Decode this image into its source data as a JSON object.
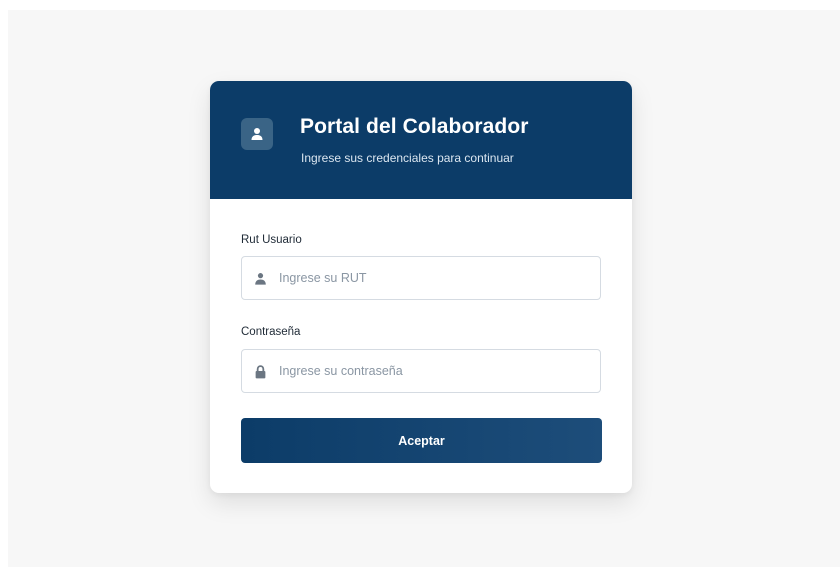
{
  "header": {
    "title": "Portal del Colaborador",
    "subtitle": "Ingrese sus credenciales para continuar",
    "icon": "user-icon"
  },
  "form": {
    "rut": {
      "label": "Rut Usuario",
      "placeholder": "Ingrese su RUT",
      "value": "",
      "icon": "user-icon"
    },
    "password": {
      "label": "Contraseña",
      "placeholder": "Ingrese su contraseña",
      "value": "",
      "icon": "lock-icon"
    },
    "submit_label": "Aceptar"
  },
  "colors": {
    "header_bg": "#0c3c68",
    "button_bg": "#0c3c68",
    "page_bg": "#f7f7f7"
  }
}
